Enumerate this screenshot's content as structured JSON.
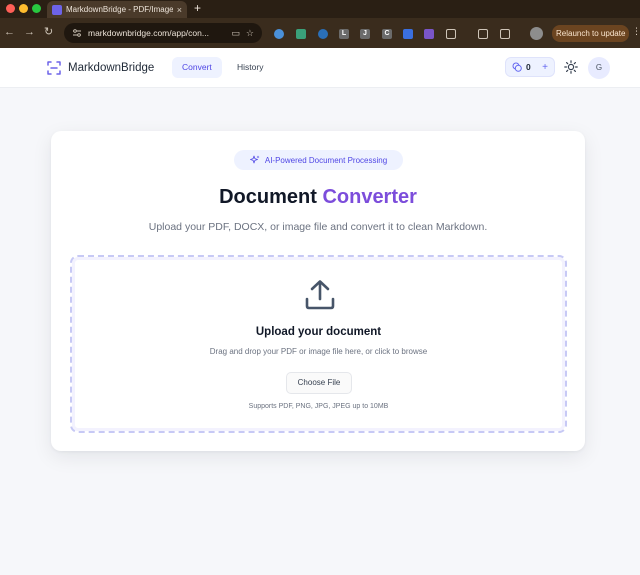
{
  "browser": {
    "tab_title": "MarkdownBridge - PDF/Image",
    "tab_close": "×",
    "new_tab": "+",
    "url": "markdownbridge.com/app/con...",
    "relaunch_label": "Relaunch to update",
    "extensions": [
      "L",
      "J",
      "C"
    ]
  },
  "header": {
    "logo_text": "MarkdownBridge",
    "nav": [
      {
        "label": "Convert",
        "active": true
      },
      {
        "label": "History",
        "active": false
      }
    ],
    "credits": "0",
    "credits_plus": "+",
    "avatar_initial": "G"
  },
  "card": {
    "badge": "AI-Powered Document Processing",
    "title_main": "Document",
    "title_accent": "Converter",
    "subtitle": "Upload your PDF, DOCX, or image file and convert it to clean Markdown.",
    "dropzone": {
      "title": "Upload your document",
      "subtitle": "Drag and drop your PDF or image file here, or click to browse",
      "button": "Choose File",
      "note": "Supports PDF, PNG, JPG, JPEG up to 10MB"
    }
  },
  "colors": {
    "accent": "#4f46e5",
    "title_accent": "#7c4ddb",
    "dropzone_border": "#c7c9f5",
    "chrome_bg": "#3a2c1d"
  },
  "icons": {
    "logo": "scan-icon",
    "badge": "sparkles-icon",
    "upload": "upload-icon",
    "credits": "coins-icon",
    "theme": "sun-icon"
  }
}
